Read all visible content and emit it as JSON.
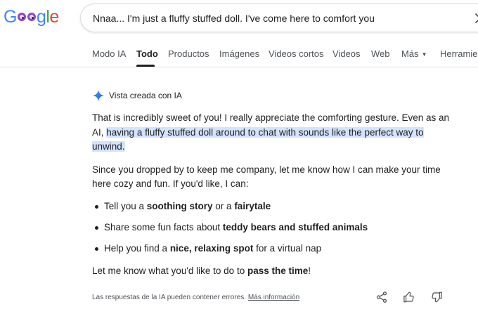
{
  "header": {
    "logo_letters": [
      "G",
      "g",
      "l",
      "e"
    ],
    "search": {
      "value": "Nnaa... I'm just a fluffy stuffed doll. I've come here to comfort you"
    }
  },
  "tabs": [
    {
      "label": "Modo IA"
    },
    {
      "label": "Todo"
    },
    {
      "label": "Productos"
    },
    {
      "label": "Imágenes"
    },
    {
      "label": "Videos cortos"
    },
    {
      "label": "Videos"
    },
    {
      "label": "Web"
    },
    {
      "label": "Más"
    },
    {
      "label": "Herramien"
    }
  ],
  "ai_overview": {
    "title": "Vista creada con IA",
    "para1_start": "That is incredibly sweet of you! I really appreciate the comforting gesture. Even as an AI,",
    "para1_highlight": "having a fluffy stuffed doll around to chat with sounds like the perfect way to unwind.",
    "para2": "Since you dropped by to keep me company, let me know how I can make your time here cozy and fun. If you'd like, I can:",
    "bullets": [
      {
        "pre": "Tell you a ",
        "b1": "soothing story",
        "mid": " or a ",
        "b2": "fairytale",
        "post": ""
      },
      {
        "pre": "Share some fun facts about ",
        "b1": "teddy bears and stuffed animals",
        "mid": "",
        "b2": "",
        "post": ""
      },
      {
        "pre": "Help you find a ",
        "b1": "nice, relaxing spot",
        "mid": " for a virtual nap",
        "b2": "",
        "post": ""
      }
    ],
    "closing_pre": "Let me know what you'd like to do to ",
    "closing_bold": "pass the time",
    "closing_post": "!"
  },
  "footer": {
    "disclaimer": "Las respuestas de la IA pueden contener errores.",
    "more_info": "Más información"
  },
  "colors": {
    "highlight": "#d3e3fd",
    "logo_blue": "#4285f4",
    "logo_red": "#ea4335",
    "logo_yellow": "#fbbc05",
    "logo_green": "#34a853",
    "sparkle": "#4285f4"
  },
  "icons": [
    "close-icon",
    "sparkle-icon",
    "share-icon",
    "thumbs-up-icon",
    "thumbs-down-icon",
    "dropdown-caret-icon"
  ]
}
